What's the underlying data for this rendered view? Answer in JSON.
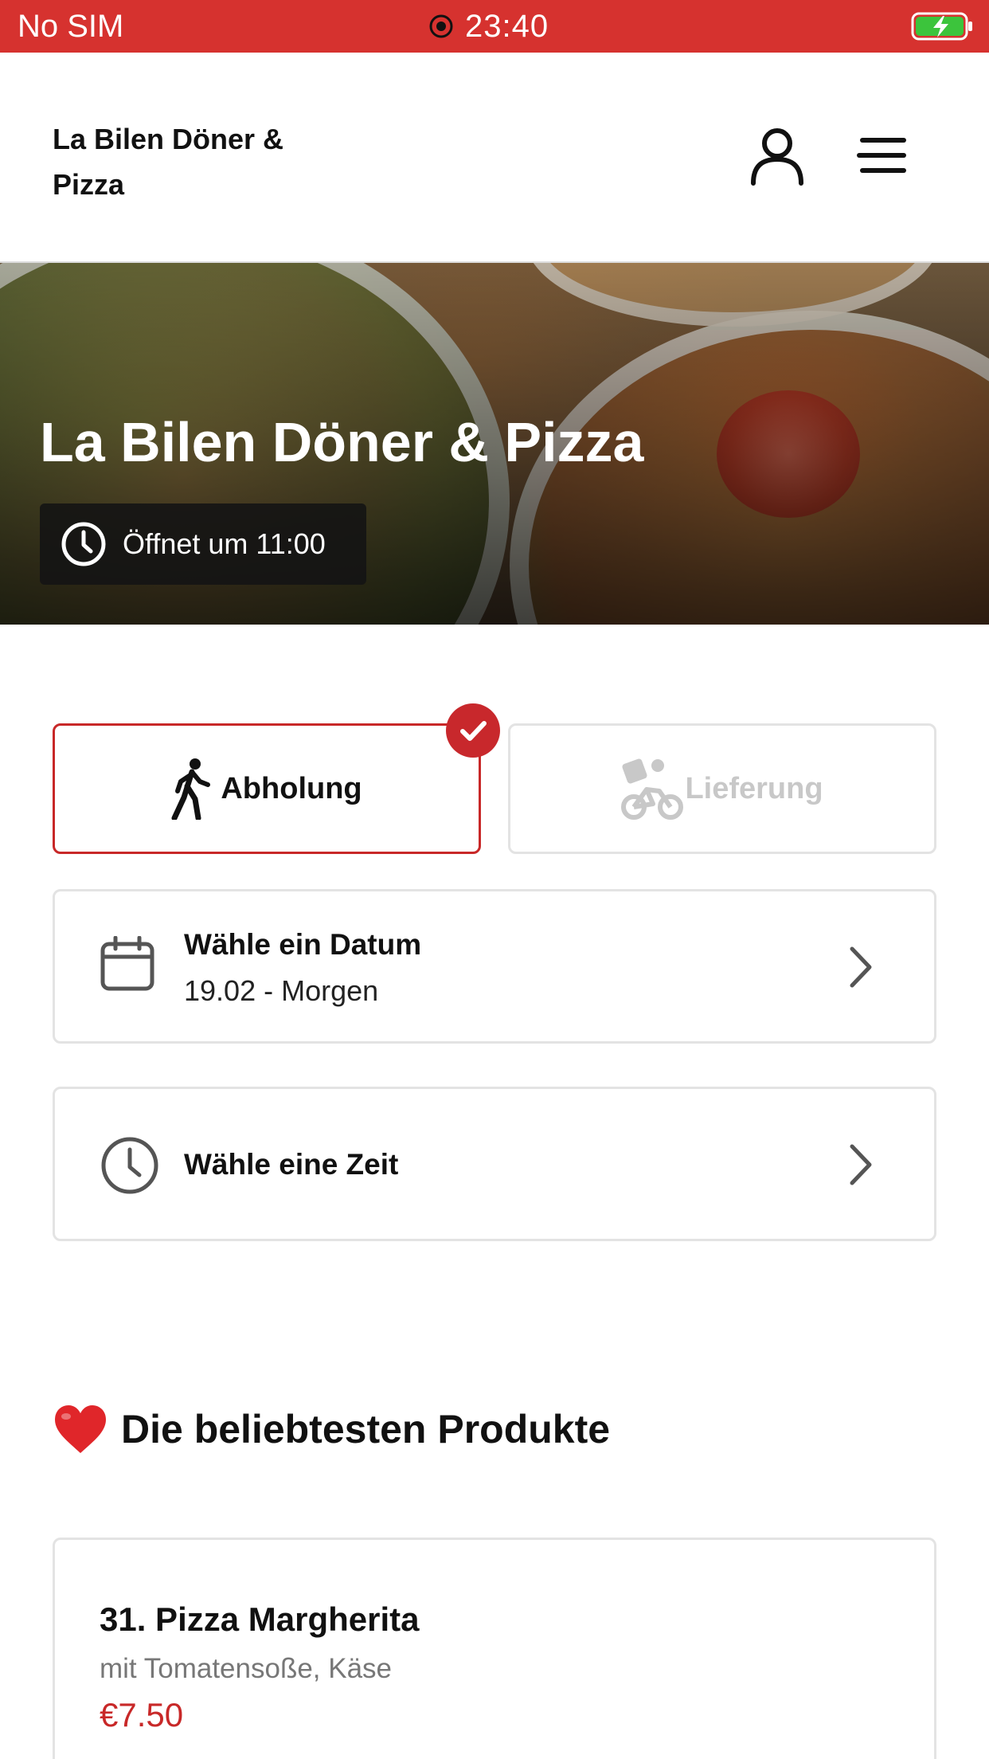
{
  "status_bar": {
    "carrier": "No SIM",
    "time": "23:40",
    "battery_state": "charging"
  },
  "header": {
    "title": "La Bilen Döner & Pizza"
  },
  "hero": {
    "title": "La Bilen Döner & Pizza",
    "opening_text": "Öffnet um 11:00"
  },
  "order_modes": {
    "pickup_label": "Abholung",
    "delivery_label": "Lieferung",
    "selected": "pickup"
  },
  "date_selector": {
    "title": "Wähle ein Datum",
    "value": "19.02 - Morgen"
  },
  "time_selector": {
    "title": "Wähle eine Zeit"
  },
  "popular": {
    "title": "Die beliebtesten Produkte",
    "products": [
      {
        "name": "31. Pizza Margherita",
        "description": "mit Tomatensoße, Käse",
        "price": "€7.50"
      }
    ]
  },
  "colors": {
    "accent": "#c82828",
    "status_bar": "#d6322f",
    "border": "#e3e3e3"
  },
  "icons": [
    "record-icon",
    "battery-charging-icon",
    "user-icon",
    "menu-icon",
    "clock-icon",
    "walking-icon",
    "check-icon",
    "bicycle-delivery-icon",
    "calendar-icon",
    "chevron-right-icon",
    "heart-icon"
  ]
}
